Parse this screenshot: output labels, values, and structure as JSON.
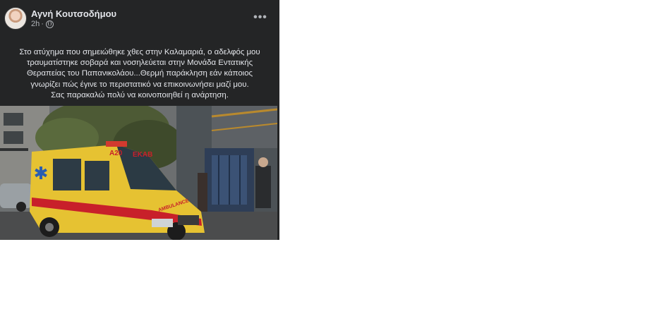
{
  "post": {
    "author": "Αγνή Κουτσοδήμου",
    "time": "2h",
    "separator": "·",
    "privacy_icon": "globe-icon",
    "more_icon": "more-options-icon",
    "more_symbol": "•••",
    "text_lines": [
      "Στο ατύχημα που σημειώθηκε χθες στην Καλαμαριά, ο αδελφός μου",
      "τραυματίστηκε σοβαρά και νοσηλεύεται στην Μονάδα Εντατικής",
      "Θεραπείας του Παπανικολάου...Θερμή παράκληση εάν κάποιος",
      "γνωρίζει πώς έγινε το περιστατικό να επικοινωνήσει μαζί μου.",
      "Σας παρακαλώ πολύ να κοινοποιηθεί η ανάρτηση."
    ],
    "image": {
      "ambulance_plate": "Α20",
      "ambulance_text": "ΕΚΑΒ",
      "ambulance_side": "AMBULANCE"
    }
  },
  "colors": {
    "card_bg": "#242526",
    "primary_text": "#e4e6eb",
    "secondary_text": "#b0b3b8",
    "ambulance_yellow": "#e6c232",
    "ambulance_red": "#c8202a"
  }
}
